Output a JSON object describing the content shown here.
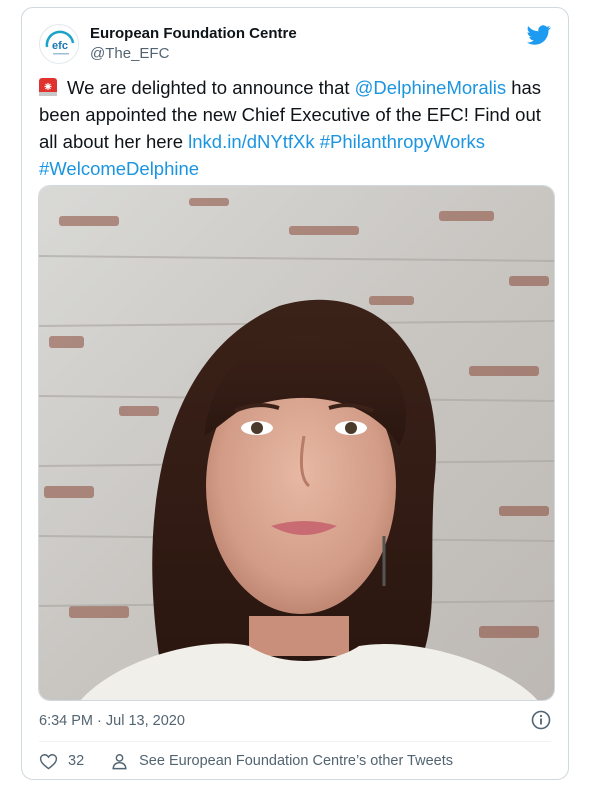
{
  "author": {
    "name": "European Foundation Centre",
    "handle": "@The_EFC",
    "avatar_text": "efc"
  },
  "tweet": {
    "text_before_mention": "We are delighted to announce that ",
    "mention": "@DelphineMoralis",
    "text_after_mention": " has been appointed the new Chief Executive of the EFC! Find out all about her here ",
    "link": "lnkd.in/dNYtfXk",
    "hashtag_1": "#PhilanthropyWorks",
    "hashtag_2": "#WelcomeDelphine",
    "emoji": "siren-emoji"
  },
  "timestamp": "6:34 PM · Jul 13, 2020",
  "actions": {
    "like_count": "32",
    "other_tweets_label": "See European Foundation Centre’s other Tweets"
  },
  "colors": {
    "link": "#1b95e0",
    "twitter_blue": "#1d9bf0",
    "secondary_text": "#536471",
    "border": "#cfd9de"
  },
  "icons": [
    "twitter-bird-icon",
    "info-icon",
    "heart-icon",
    "person-icon"
  ]
}
